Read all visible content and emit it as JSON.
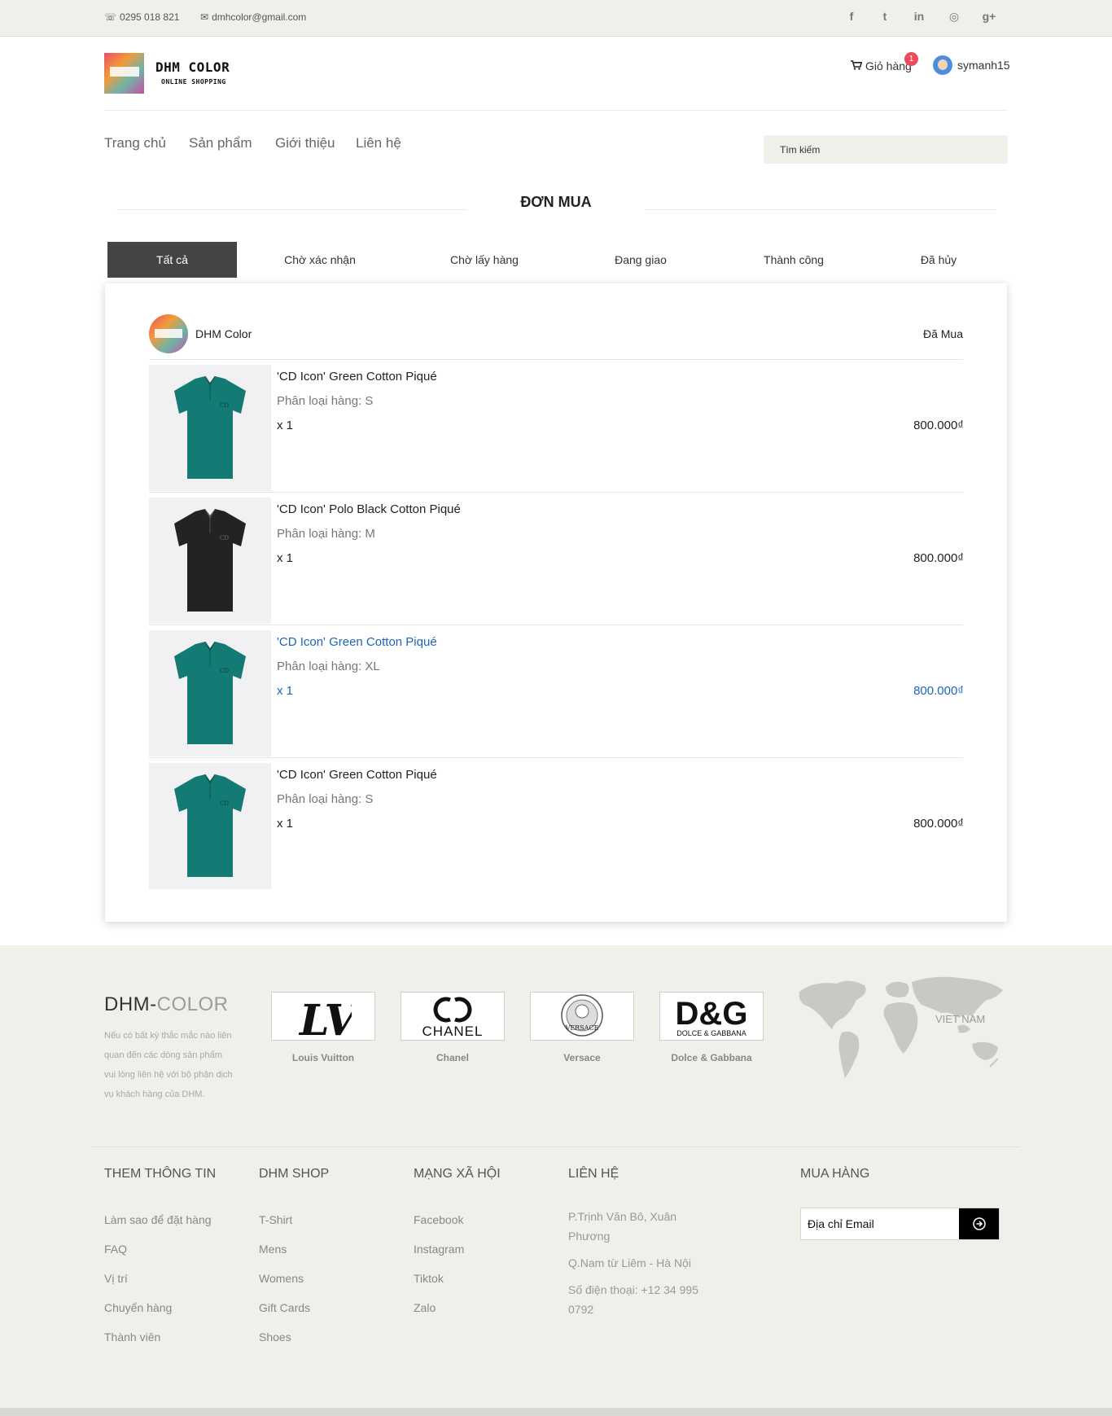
{
  "topbar": {
    "phone": "0295 018 821",
    "email": "dmhcolor@gmail.com",
    "social": [
      {
        "icon": "facebook-icon",
        "glyph": "f"
      },
      {
        "icon": "twitter-icon",
        "glyph": "t"
      },
      {
        "icon": "linkedin-icon",
        "glyph": "in"
      },
      {
        "icon": "dribbble-icon",
        "glyph": "◎"
      },
      {
        "icon": "google-plus-icon",
        "glyph": "g+"
      }
    ]
  },
  "header": {
    "logo_title": "DHM COLOR",
    "logo_subtitle": "ONLINE SHOPPING",
    "cart_label": "Giỏ hàng",
    "cart_count": "1",
    "username": "symanh15"
  },
  "nav": {
    "items": [
      "Trang chủ",
      "Sản phẩm",
      "Giới thiệu",
      "Liên hệ"
    ],
    "search_placeholder": "Tìm kiếm"
  },
  "page": {
    "title": "ĐƠN MUA",
    "tabs": [
      "Tất cả",
      "Chờ xác nhận",
      "Chờ lấy hàng",
      "Đang giao",
      "Thành công",
      "Đã hủy"
    ],
    "active_tab": "Tất cả"
  },
  "order": {
    "shop_name": "DHM Color",
    "status": "Đã Mua",
    "items": [
      {
        "name": "'CD Icon' Green Cotton Piqué",
        "variant": "Phân loại hàng: S",
        "qty": "x 1",
        "price": "800.000₫",
        "shirt_color": "#137a74"
      },
      {
        "name": "'CD Icon' Polo Black Cotton Piqué",
        "variant": "Phân loại hàng: M",
        "qty": "x 1",
        "price": "800.000₫",
        "shirt_color": "#242222"
      },
      {
        "name": "'CD Icon' Green Cotton Piqué",
        "variant": "Phân loại hàng: XL",
        "qty": "x 1",
        "price": "800.000₫",
        "shirt_color": "#137a74"
      },
      {
        "name": "'CD Icon' Green Cotton Piqué",
        "variant": "Phân loại hàng: S",
        "qty": "x 1",
        "price": "800.000₫",
        "shirt_color": "#137a74"
      }
    ]
  },
  "footer": {
    "brand_main": "DHM-",
    "brand_accent": "COLOR",
    "description": "Nếu có bất kỳ thắc mắc nào liên quan đến các dòng sản phẩm vui lòng liên hệ với bộ phận dịch vụ khách hàng của DHM.",
    "brands": [
      {
        "name": "Louis Vuitton",
        "logo": "LV"
      },
      {
        "name": "Chanel",
        "logo": "CHANEL"
      },
      {
        "name": "Versace",
        "logo": "VERSACE"
      },
      {
        "name": "Dolce & Gabbana",
        "logo": "D&G",
        "logo_sub": "DOLCE & GABBANA"
      }
    ],
    "map_label": "VIET NAM",
    "columns": {
      "info": {
        "heading": "THEM THÔNG TIN",
        "links": [
          "Làm sao để đặt hàng",
          "FAQ",
          "Vị trí",
          "Chuyển hàng",
          "Thành viên"
        ]
      },
      "shop": {
        "heading": "DHM SHOP",
        "links": [
          "T-Shirt",
          "Mens",
          "Womens",
          "Gift Cards",
          "Shoes"
        ]
      },
      "social": {
        "heading": "MẠNG XÃ HỘI",
        "links": [
          "Facebook",
          "Instagram",
          "Tiktok",
          "Zalo"
        ]
      },
      "contact": {
        "heading": "LIÊN HỆ",
        "address1": "P.Trịnh Văn Bô, Xuân Phương",
        "address2": "Q.Nam từ Liêm - Hà Nội",
        "phone": "Số điện thoại: +12 34 995 0792"
      },
      "buy": {
        "heading": "MUA HÀNG",
        "email_placeholder": "Địa chỉ Email"
      }
    }
  },
  "colors": {
    "accent_link": "#1a66b8",
    "active_tab": "#444444",
    "badge": "#ee4a5a",
    "footer_bg": "#f0efea"
  }
}
